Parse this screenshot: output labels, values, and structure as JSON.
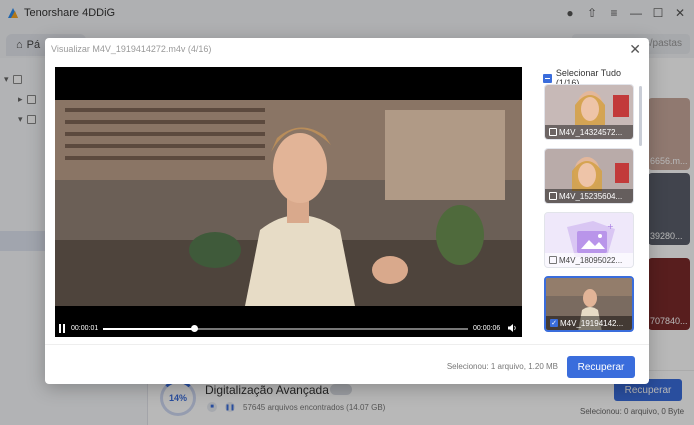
{
  "app": {
    "title": "Tenorshare 4DDiG",
    "home_tab": "Pá",
    "search_placeholder": "os/pastas"
  },
  "background": {
    "scan_percent": "14%",
    "scan_title": "Digitalização Avançada",
    "ai_badge": "AI",
    "scan_count": "57645 arquivos encontrados (14.07 GB)",
    "recover_label": "Recuperar",
    "selected_info": "Selecionou: 0 arquivo, 0 Byte",
    "thumb_labels": [
      "6656.m...",
      "39280...",
      "707840..."
    ]
  },
  "modal": {
    "title": "Visualizar M4V_1919414272.m4v (4/16)",
    "select_all": "Selecionar Tudo (1/16)",
    "player": {
      "time_current": "00:00:01",
      "time_total": "00:00:06",
      "progress": 0.25
    },
    "thumbnails": [
      {
        "label": "M4V_14324572...",
        "checked": false
      },
      {
        "label": "M4V_15235604...",
        "checked": false
      },
      {
        "label": "M4V_18095022...",
        "checked": false
      },
      {
        "label": "M4V_19194142...",
        "checked": true
      }
    ],
    "footer_selected": "Selecionou: 1 arquivo, 1.20 MB",
    "recover_label": "Recuperar"
  },
  "colors": {
    "accent": "#3a6ddc"
  }
}
